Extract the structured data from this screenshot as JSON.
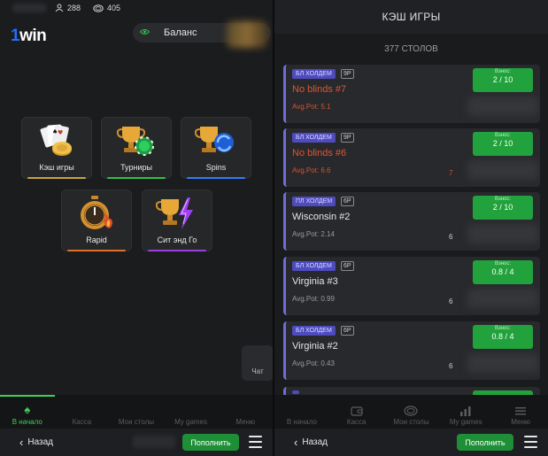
{
  "left": {
    "stats": {
      "players": "288",
      "tables": "405"
    },
    "logo": {
      "one": "1",
      "rest": "win"
    },
    "balance_label": "Баланс",
    "tiles": [
      {
        "label": "Кэш игры",
        "icon": "cards-chips-icon",
        "glow": "#c9a23a"
      },
      {
        "label": "Турниры",
        "icon": "trophy-chip-icon",
        "glow": "#2fbf4a"
      },
      {
        "label": "Spins",
        "icon": "trophy-spin-icon",
        "glow": "#2f7dff"
      },
      {
        "label": "Rapid",
        "icon": "stopwatch-flame-icon",
        "glow": "#e0702a"
      },
      {
        "label": "Сит энд Го",
        "icon": "trophy-bolt-icon",
        "glow": "#9b3fe0"
      }
    ],
    "chat_label": "Чат",
    "nav": [
      {
        "label": "В начало",
        "icon": "spade-icon",
        "active": true
      },
      {
        "label": "Касса",
        "icon": "wallet-icon",
        "active": false
      },
      {
        "label": "Мои столы",
        "icon": "table-icon",
        "active": false
      },
      {
        "label": "My games",
        "icon": "bars-icon",
        "active": false
      },
      {
        "label": "Меню",
        "icon": "menu-icon",
        "active": false
      }
    ],
    "footer": {
      "back_label": "Назад",
      "topup_label": "Пополнить"
    }
  },
  "right": {
    "title": "КЭШ ИГРЫ",
    "tables_count": "377 СТОЛОВ",
    "tables": [
      {
        "type": "БЛ ХОЛДЕМ",
        "seats": "9Р",
        "name": "No blinds #7",
        "pot": "Avg.Pot: 5.1",
        "count": "",
        "buyin_label": "Взнос:",
        "buyin": "2 / 10",
        "highlight": true
      },
      {
        "type": "БЛ ХОЛДЕМ",
        "seats": "9Р",
        "name": "No blinds #6",
        "pot": "Avg.Pot: 6.6",
        "count": "7",
        "buyin_label": "Взнос:",
        "buyin": "2 / 10",
        "highlight": true
      },
      {
        "type": "ПЛ ХОЛДЕМ",
        "seats": "6Р",
        "name": "Wisconsin #2",
        "pot": "Avg.Pot: 2.14",
        "count": "6",
        "buyin_label": "Взнос:",
        "buyin": "2 / 10",
        "highlight": false
      },
      {
        "type": "БЛ ХОЛДЕМ",
        "seats": "6Р",
        "name": "Virginia #3",
        "pot": "Avg.Pot: 0.99",
        "count": "6",
        "buyin_label": "Взнос:",
        "buyin": "0.8 / 4",
        "highlight": false
      },
      {
        "type": "БЛ ХОЛДЕМ",
        "seats": "6Р",
        "name": "Virginia #2",
        "pot": "Avg.Pot: 0.43",
        "count": "6",
        "buyin_label": "Взнос:",
        "buyin": "0.8 / 4",
        "highlight": false
      }
    ],
    "nav": [
      {
        "label": "В начало",
        "icon": "spade-icon",
        "active": false
      },
      {
        "label": "Касса",
        "icon": "wallet-icon",
        "active": false
      },
      {
        "label": "Мои столы",
        "icon": "table-icon",
        "active": false
      },
      {
        "label": "My games",
        "icon": "bars-icon",
        "active": false
      },
      {
        "label": "Меню",
        "icon": "menu-icon",
        "active": false
      }
    ],
    "footer": {
      "back_label": "Назад",
      "topup_label": "Пополнить"
    }
  }
}
